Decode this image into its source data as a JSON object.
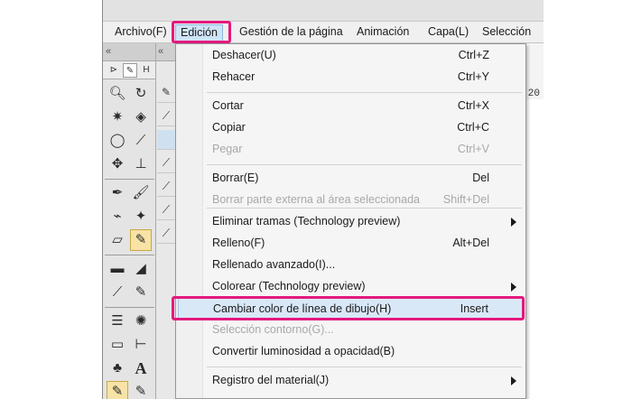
{
  "menubar": {
    "items": [
      {
        "label": "Archivo(F)"
      },
      {
        "label": "Edición"
      },
      {
        "label": "Gestión de la página"
      },
      {
        "label": "Animación"
      },
      {
        "label": "Capa(L)"
      },
      {
        "label": "Selección"
      }
    ],
    "active_index": 1
  },
  "ruler": {
    "number": "20"
  },
  "edit_menu": {
    "items": [
      {
        "label": "Deshacer(U)",
        "shortcut": "Ctrl+Z",
        "enabled": true
      },
      {
        "label": "Rehacer",
        "shortcut": "Ctrl+Y",
        "enabled": true
      },
      {
        "label": "Cortar",
        "shortcut": "Ctrl+X",
        "enabled": true
      },
      {
        "label": "Copiar",
        "shortcut": "Ctrl+C",
        "enabled": true
      },
      {
        "label": "Pegar",
        "shortcut": "Ctrl+V",
        "enabled": false
      },
      {
        "label": "Borrar(E)",
        "shortcut": "Del",
        "enabled": true
      },
      {
        "label": "Borrar parte externa al área seleccionada",
        "shortcut": "Shift+Del",
        "enabled": false
      },
      {
        "label": "Eliminar tramas (Technology preview)",
        "shortcut": "",
        "enabled": true,
        "submenu": true
      },
      {
        "label": "Relleno(F)",
        "shortcut": "Alt+Del",
        "enabled": true
      },
      {
        "label": "Rellenado avanzado(I)...",
        "shortcut": "",
        "enabled": true
      },
      {
        "label": "Colorear (Technology preview)",
        "shortcut": "",
        "enabled": true,
        "submenu": true
      },
      {
        "label": "Cambiar color de línea de dibujo(H)",
        "shortcut": "Insert",
        "enabled": true,
        "highlighted": true
      },
      {
        "label": "Selección contorno(G)...",
        "shortcut": "",
        "enabled": false
      },
      {
        "label": "Convertir luminosidad a opacidad(B)",
        "shortcut": "",
        "enabled": true
      },
      {
        "label": "Registro del material(J)",
        "shortcut": "",
        "enabled": true,
        "submenu": true
      }
    ]
  },
  "colors": {
    "annotation_highlight": "#e4197e",
    "menu_hover": "#d9e8f7",
    "disabled_text": "#a8a8a8"
  },
  "icons": [
    "zoom-icon",
    "rotate-icon",
    "auto-select-icon",
    "object-icon",
    "lasso-icon",
    "eyedropper-icon",
    "move-icon",
    "stamp-icon",
    "pen-icon",
    "brush-icon",
    "airbrush-icon",
    "sparkle-icon",
    "eraser-icon",
    "blend-icon",
    "fill-icon",
    "gradient-icon",
    "shape-icon",
    "ruler-icon",
    "pattern-icon",
    "burst-icon",
    "frame-icon",
    "vector-icon",
    "palette-icon",
    "text-icon"
  ]
}
